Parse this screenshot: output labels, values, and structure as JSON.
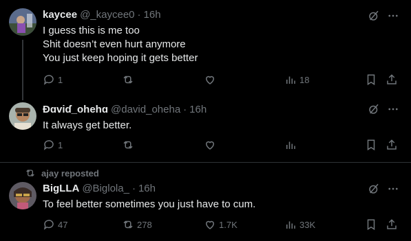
{
  "posts": [
    {
      "name": "kaycee",
      "handle": "@_kaycee0",
      "dot": "·",
      "time": "16h",
      "lines": [
        "I guess this is me too",
        "Shit doesn’t even hurt anymore",
        "You just keep hoping it gets better"
      ],
      "replies": "1",
      "reposts": "",
      "likes": "",
      "views": "18"
    },
    {
      "name": "Ɖɑviɗ_ohehɑ",
      "handle": "@david_oheha",
      "dot": "·",
      "time": "16h",
      "lines": [
        "It always get better."
      ],
      "replies": "1",
      "reposts": "",
      "likes": "",
      "views": ""
    },
    {
      "name": "BigLLA",
      "handle": "@Biglola_",
      "dot": "·",
      "time": "16h",
      "lines": [
        "To feel better sometimes you just have to cum."
      ],
      "replies": "47",
      "reposts": "278",
      "likes": "1.7K",
      "views": "33K"
    }
  ],
  "repost_banner": "ajay reposted",
  "icons": [
    "grok-icon",
    "more-icon",
    "reply-icon",
    "repost-icon",
    "like-icon",
    "views-icon",
    "bookmark-icon",
    "share-icon"
  ],
  "colors": {
    "background": "#000000",
    "text": "#e7e9ea",
    "muted": "#71767b",
    "border": "#2f3336"
  }
}
